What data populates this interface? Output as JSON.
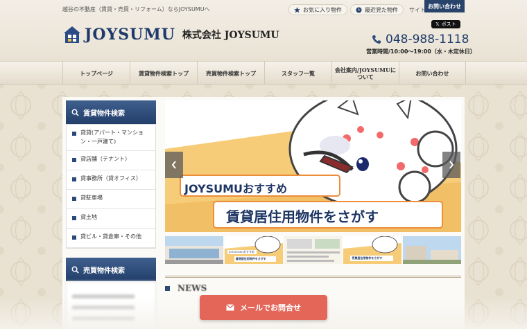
{
  "header": {
    "tagline": "越谷の不動産（賃貸・売買・リフォーム）ならJOYSUMUへ",
    "favorites": "お気に入り物件",
    "recently_viewed": "最近見た物件",
    "sitemap": "サイトマップ",
    "contact_tab": "お問い合わせ",
    "brand": "JOYSUMU",
    "company": "株式会社 JOYSUMU",
    "x_post": "ポスト",
    "phone": "048-988-1118",
    "hours": "営業時間/10:00～19:00（水・木定休日）"
  },
  "nav": {
    "items": [
      "トップページ",
      "賃貸物件検索トップ",
      "売買物件検索トップ",
      "スタッフ一覧",
      "会社案内/JOYSUMUについて",
      "お問い合わせ"
    ]
  },
  "sidebar": {
    "rent_title": "賃貸物件検索",
    "rent_items": [
      "貸貸(アパート・マンション・一戸建て)",
      "貸店舗（テナント）",
      "貸事務所（貸オフィス）",
      "貸駐車場",
      "貸土地",
      "貸ビル・貸倉庫・その他"
    ],
    "sale_title": "売買物件検索"
  },
  "slider": {
    "badge": "JOYSUMUおすすめ",
    "headline": "賃貸居住用物件をさがす"
  },
  "thumbs": {
    "label_joysumu": "JOYSUMUおすすめ",
    "label_rent": "賃貸居住用物件をさがす",
    "label_sale": "売買居住用物件をさがす"
  },
  "news": {
    "title": "NEWS"
  },
  "mail_button": "メールでお問合せ",
  "colors": {
    "navy": "#29446b",
    "brand": "#1e3a6a",
    "mail": "#e36659",
    "banner_yellow": "#f7d27a"
  }
}
